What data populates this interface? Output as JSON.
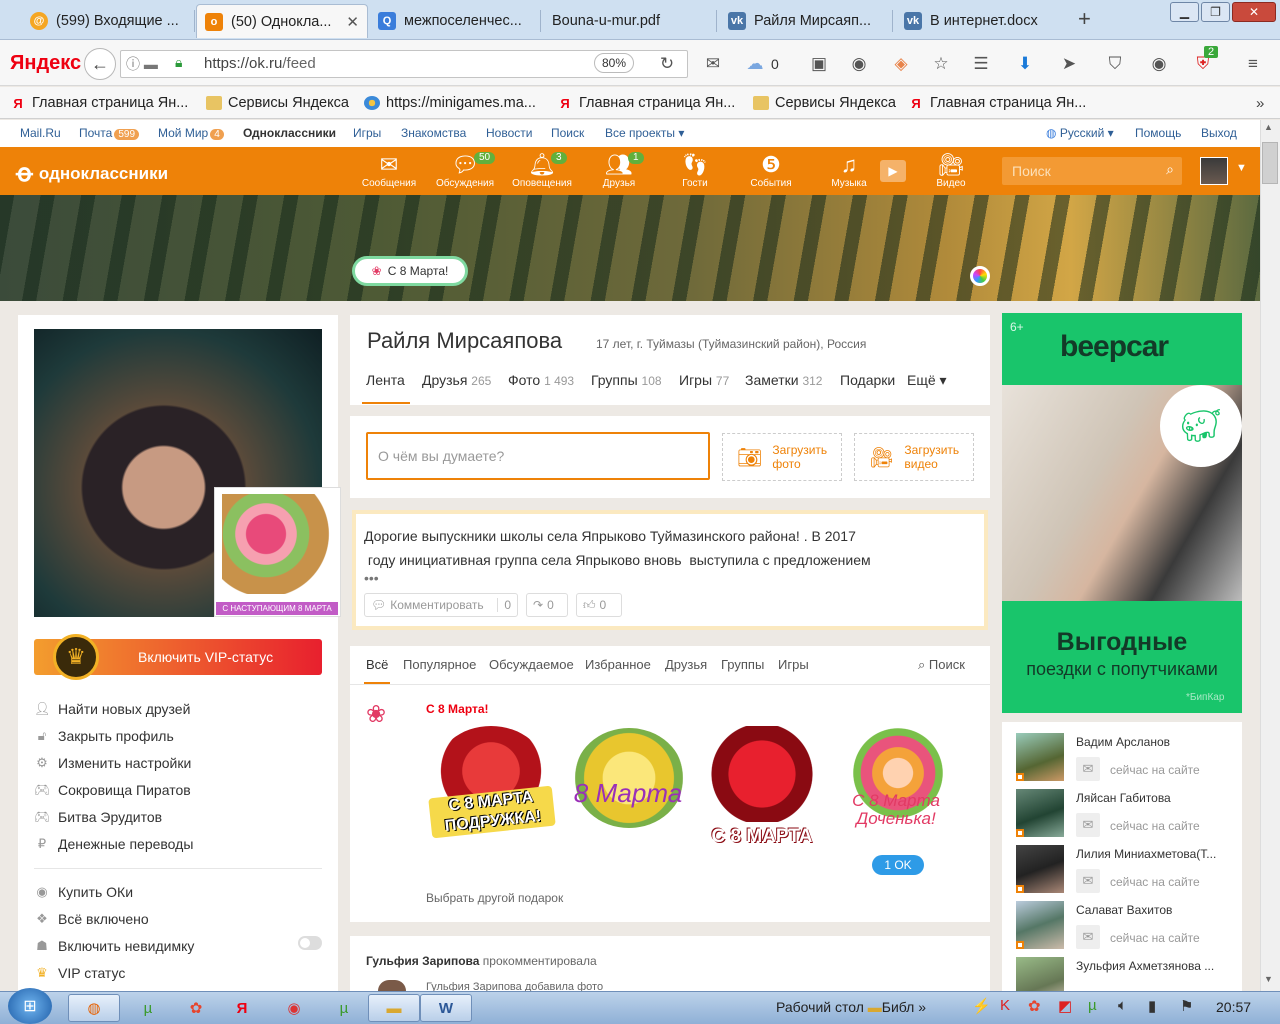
{
  "browser": {
    "tabs": [
      {
        "title": "(599) Входящие ..."
      },
      {
        "title": "(50) Однокла..."
      },
      {
        "title": "межпоселенчес..."
      },
      {
        "title": "Bouna-u-mur.pdf"
      },
      {
        "title": "Райля Мирсаяп..."
      },
      {
        "title": "В интернет.docx"
      }
    ],
    "brand": "Яндекс",
    "url_host": "https://ok.ru",
    "url_path": "/feed",
    "zoom": "80%",
    "cloud_count": "0",
    "ext_badge": "2",
    "bookmarks": [
      "Главная страница Ян...",
      "Сервисы Яндекса",
      "https://minigames.ma...",
      "Главная страница Ян...",
      "Сервисы Яндекса",
      "Главная страница Ян..."
    ]
  },
  "portal": {
    "links": [
      "Mail.Ru",
      "Почта",
      "Мой Мир",
      "Одноклассники",
      "Игры",
      "Знакомства",
      "Новости",
      "Поиск",
      "Все проекты ▾"
    ],
    "mail_count": "599",
    "mir_count": "4",
    "lang": "Русский ▾",
    "help": "Помощь",
    "logout": "Выход"
  },
  "ok_header": {
    "logo": "одноклассники",
    "nav": [
      {
        "label": "Сообщения",
        "icon": "envelope-icon",
        "count": ""
      },
      {
        "label": "Обсуждения",
        "icon": "chat-icon",
        "count": "50"
      },
      {
        "label": "Оповещения",
        "icon": "bell-icon",
        "count": "3"
      },
      {
        "label": "Друзья",
        "icon": "friends-icon",
        "count": "1"
      },
      {
        "label": "Гости",
        "icon": "footprints-icon",
        "count": ""
      },
      {
        "label": "События",
        "icon": "events-icon",
        "count": ""
      },
      {
        "label": "Музыка",
        "icon": "music-icon",
        "count": ""
      },
      {
        "label": "Видео",
        "icon": "video-icon",
        "count": ""
      }
    ],
    "search_placeholder": "Поиск"
  },
  "cover": {
    "march_badge": "С 8 Марта!"
  },
  "left": {
    "gift_caption": "С НАСТУПАЮЩИМ 8 МАРТА",
    "vip_button": "Включить VIP-статус",
    "menu1": [
      {
        "label": "Найти новых друзей",
        "icon": "person-icon"
      },
      {
        "label": "Закрыть профиль",
        "icon": "lock-icon"
      },
      {
        "label": "Изменить настройки",
        "icon": "gear-icon"
      },
      {
        "label": "Сокровища Пиратов",
        "icon": "gamepad-icon"
      },
      {
        "label": "Битва Эрудитов",
        "icon": "gamepad-icon"
      },
      {
        "label": "Денежные переводы",
        "icon": "money-icon"
      }
    ],
    "menu2": [
      {
        "label": "Купить ОКи",
        "icon": "coin-icon"
      },
      {
        "label": "Всё включено",
        "icon": "gift-box-icon"
      },
      {
        "label": "Включить невидимку",
        "icon": "hat-icon"
      },
      {
        "label": "VIP статус",
        "icon": "crown-icon"
      }
    ]
  },
  "profile": {
    "name": "Райля Мирсаяпова",
    "meta": "17 лет, г. Туймазы (Туймазинский район), Россия",
    "tabs": [
      {
        "label": "Лента",
        "count": ""
      },
      {
        "label": "Друзья",
        "count": "265"
      },
      {
        "label": "Фото",
        "count": "1 493"
      },
      {
        "label": "Группы",
        "count": "108"
      },
      {
        "label": "Игры",
        "count": "77"
      },
      {
        "label": "Заметки",
        "count": "312"
      },
      {
        "label": "Подарки",
        "count": ""
      },
      {
        "label": "Ещё ▾",
        "count": ""
      }
    ]
  },
  "composer": {
    "placeholder": "О чём вы думаете?",
    "upload_photo": [
      "Загрузить",
      "фото"
    ],
    "upload_video": [
      "Загрузить",
      "видео"
    ]
  },
  "topic": {
    "line1": "Дорогие выпускники школы села Япрыково Туймазинского района! . В 2017",
    "line2": " году инициативная группа села Япрыково вновь  выступила с предложением",
    "more": "•••",
    "comment_label": "Комментировать",
    "comment_count": "0",
    "share_count": "0",
    "like_count": "0"
  },
  "feed": {
    "tabs": [
      "Всё",
      "Популярное",
      "Обсуждаемое",
      "Избранное",
      "Друзья",
      "Группы",
      "Игры"
    ],
    "search": "Поиск",
    "gift_block": {
      "title": "С 8 Марта!",
      "gifts": [
        {
          "text": "С 8 МАРТА ПОДРУЖКА!",
          "color": "#e01c1c"
        },
        {
          "text": "8 Марта",
          "color": "#f0d23a"
        },
        {
          "text": "С 8 МАРТА",
          "color": "#c8101c"
        },
        {
          "text": "С 8 Марта Доченька!",
          "color": "#f07aa0"
        }
      ],
      "price": "1 OK",
      "choose_other": "Выбрать другой подарок"
    },
    "next_item": {
      "author": "Гульфия Зарипова",
      "action": "прокомментировала",
      "sub": "Гульфия Зарипова добавила фото"
    }
  },
  "ad": {
    "age": "6+",
    "brand": "beepcar",
    "headline": "Выгодные",
    "subline": "поездки с попутчиками",
    "source": "*БипКар",
    "accent": "#19c56b"
  },
  "friends_online": [
    {
      "name": "Вадим Арсланов",
      "status": "сейчас на сайте"
    },
    {
      "name": "Ляйсан Габитова",
      "status": "сейчас на сайте"
    },
    {
      "name": "Лилия Миниахметова(Т...",
      "status": "сейчас на сайте"
    },
    {
      "name": "Салават Вахитов",
      "status": "сейчас на сайте"
    },
    {
      "name": "Зульфия Ахметзянова ...",
      "status": ""
    }
  ],
  "taskbar": {
    "desktop_label": "Рабочий стол",
    "folder_label": "Библ",
    "time": "20:57"
  },
  "colors": {
    "ok_orange": "#ee8208",
    "link_blue": "#2f5f96",
    "badge_green": "#62b03c"
  }
}
